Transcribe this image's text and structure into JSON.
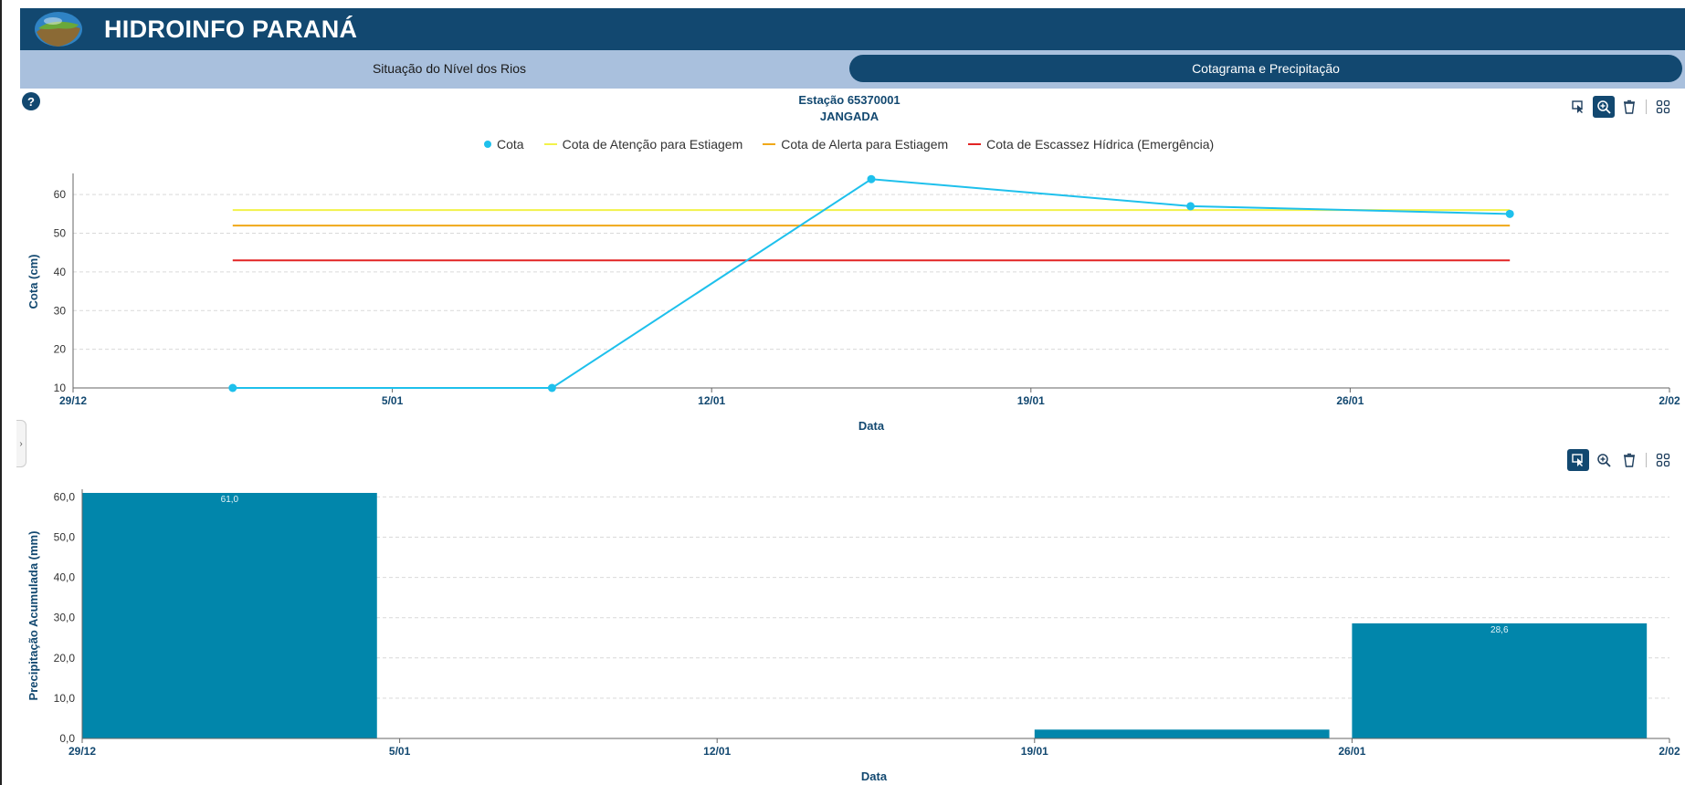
{
  "app": {
    "title": "HIDROINFO PARANÁ"
  },
  "tabs": [
    {
      "label": "Situação do Nível dos Rios",
      "active": false
    },
    {
      "label": "Cotagrama e Precipitação",
      "active": true
    }
  ],
  "help_label": "?",
  "station": {
    "code_line": "Estação 65370001",
    "name": "JANGADA"
  },
  "toolbar_icons": [
    "select-icon",
    "zoom-icon",
    "clear-icon",
    "grid-icon"
  ],
  "colors": {
    "header": "#124870",
    "tabbar": "#a9c0dd",
    "cota": "#1ec0ec",
    "atencao": "#f2f24a",
    "alerta": "#f0a818",
    "escassez": "#e22424",
    "bar": "#0186ab"
  },
  "chart_data": [
    {
      "type": "line",
      "title": "",
      "legend_position": "top-center",
      "x_ticks": [
        "29/12",
        "5/01",
        "12/01",
        "19/01",
        "26/01",
        "2/02"
      ],
      "xlabel": "Data",
      "ylabel": "Cota (cm)",
      "y_ticks": [
        "10",
        "20",
        "30",
        "40",
        "50",
        "60"
      ],
      "ylim": [
        10,
        65
      ],
      "x_days_range": [
        0,
        35
      ],
      "series": [
        {
          "name": "Cota",
          "x": [
            "2025-01-02",
            "2025-01-09",
            "2025-01-16",
            "2025-01-23",
            "2025-01-30"
          ],
          "x_days": [
            3.5,
            10.5,
            17.5,
            24.5,
            31.5
          ],
          "values": [
            10,
            10,
            64,
            57,
            55
          ]
        },
        {
          "name": "Cota de Atenção para Estiagem",
          "x_days": [
            3.5,
            31.5
          ],
          "values": [
            56,
            56
          ]
        },
        {
          "name": "Cota de Alerta para Estiagem",
          "x_days": [
            3.5,
            31.5
          ],
          "values": [
            52,
            52
          ]
        },
        {
          "name": "Cota de Escassez Hídrica (Emergência)",
          "x_days": [
            3.5,
            31.5
          ],
          "values": [
            43,
            43
          ]
        }
      ]
    },
    {
      "type": "bar",
      "xlabel": "Data",
      "ylabel": "Precipitação Acumulada (mm)",
      "x_ticks": [
        "29/12",
        "5/01",
        "12/01",
        "19/01",
        "26/01",
        "2/02"
      ],
      "y_ticks": [
        "0,0",
        "10,0",
        "20,0",
        "30,0",
        "40,0",
        "50,0",
        "60,0"
      ],
      "ylim": [
        0,
        61
      ],
      "x_days_range": [
        0,
        35
      ],
      "bars": [
        {
          "start_day": 0.0,
          "end_day": 6.5,
          "value": 61.0,
          "label": "61,0"
        },
        {
          "start_day": 21.0,
          "end_day": 27.5,
          "value": 2.2,
          "label": ""
        },
        {
          "start_day": 28.0,
          "end_day": 34.5,
          "value": 28.6,
          "label": "28,6"
        }
      ]
    }
  ]
}
